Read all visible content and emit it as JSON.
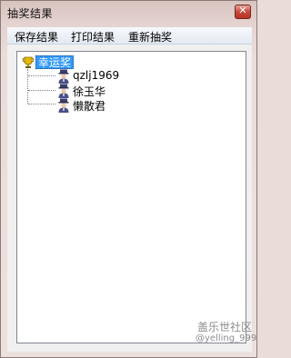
{
  "window": {
    "title": "抽奖结果",
    "close_glyph": "✕"
  },
  "menu": {
    "items": [
      {
        "label": "保存结果"
      },
      {
        "label": "打印结果"
      },
      {
        "label": "重新抽奖"
      }
    ]
  },
  "tree": {
    "root": {
      "label": "幸运奖",
      "icon": "trophy-icon"
    },
    "children": [
      {
        "label": "qzlj1969",
        "icon": "person-icon"
      },
      {
        "label": "徐玉华",
        "icon": "person-icon"
      },
      {
        "label": "懒散君",
        "icon": "person-icon"
      }
    ]
  },
  "watermark": {
    "line1": "盖乐世社区",
    "line2": "@yelling_999"
  }
}
